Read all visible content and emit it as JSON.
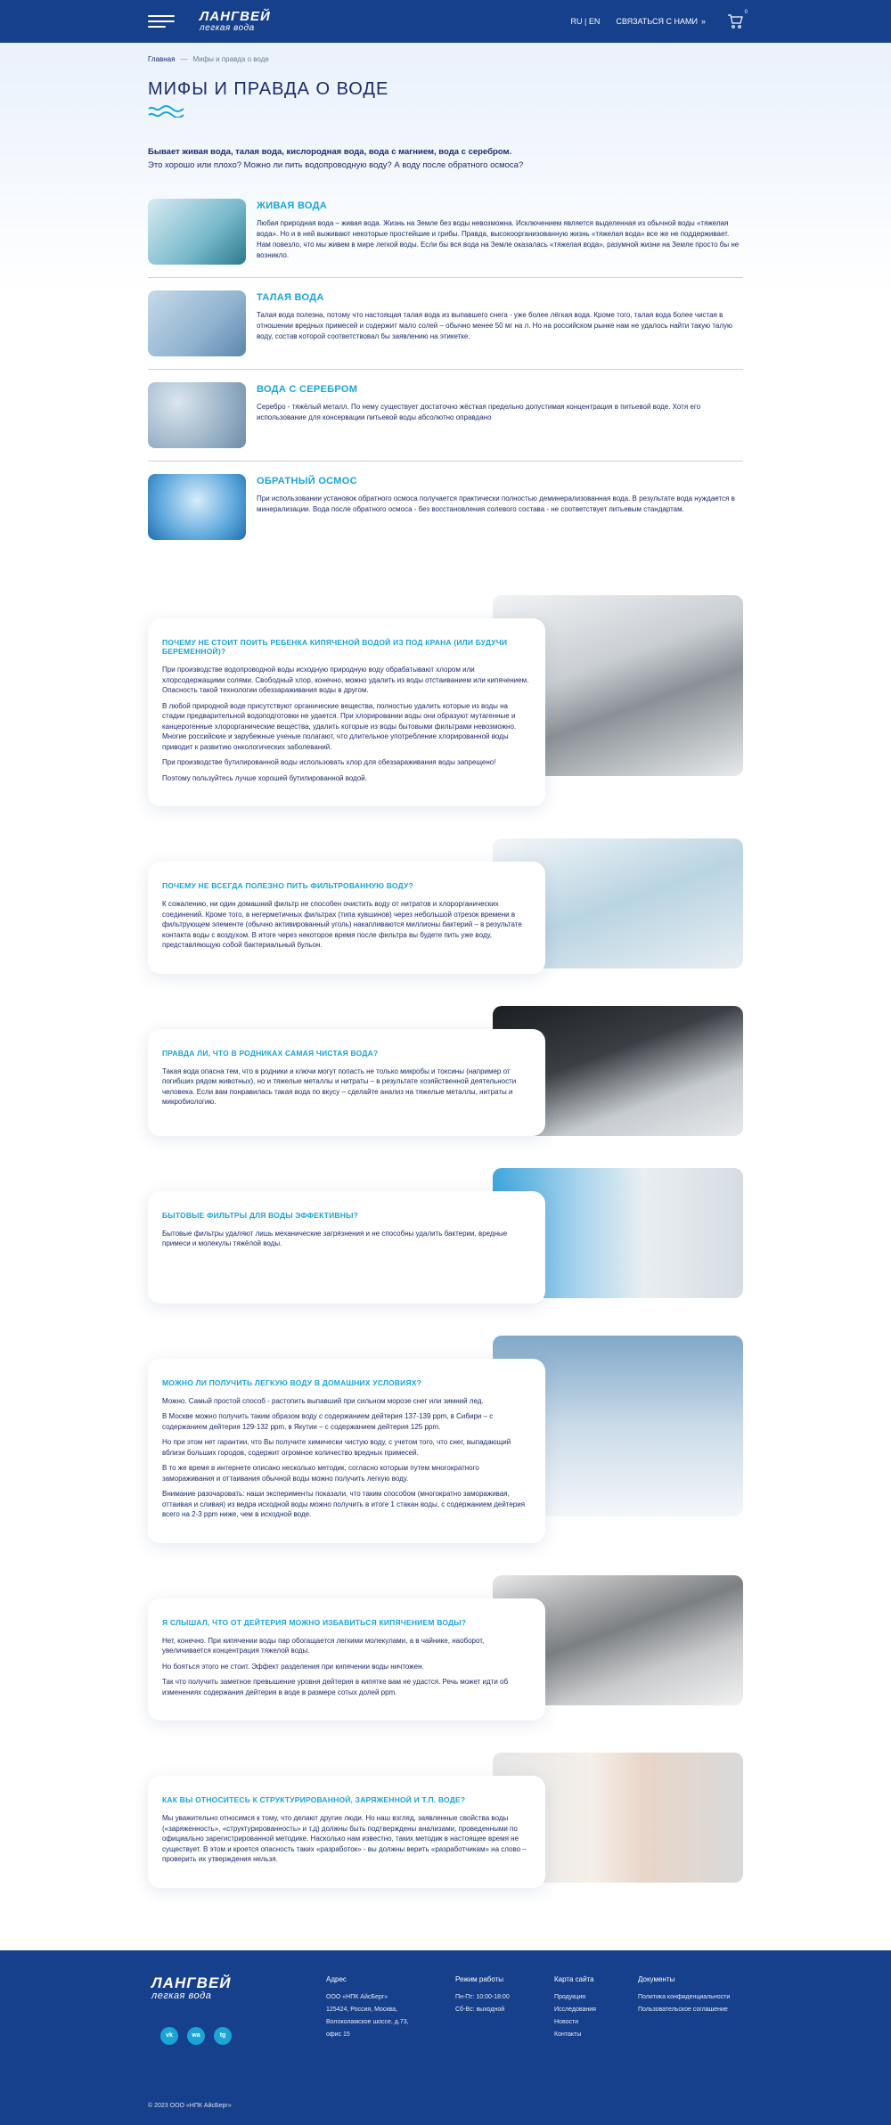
{
  "header": {
    "logo_main": "ЛАНГВЕЙ",
    "logo_sub": "легкая вода",
    "lang": "RU | EN",
    "contact": "СВЯЗАТЬСЯ С НАМИ",
    "cart_count": "0"
  },
  "breadcrumb": {
    "home": "Главная",
    "sep": "—",
    "current": "Мифы и правда о воде"
  },
  "title": "МИФЫ И ПРАВДА О ВОДЕ",
  "intro": {
    "bold": "Бывает живая вода, талая вода, кислородная вода, вода с магнием, вода с серебром.",
    "normal": "Это хорошо или плохо? Можно ли пить водопроводную воду? А воду после обратного осмоса?"
  },
  "topics": [
    {
      "title": "ЖИВАЯ ВОДА",
      "text": "Любая природная вода – живая вода. Жизнь на Земле без воды невозможна. Исключением является выделенная из обычной воды «тяжелая вода». Но и в ней выживают некоторые простейшие и грибы. Правда, высокоорганизованную жизнь «тяжелая вода» все же не поддерживает. Нам повезло, что мы живем в мире легкой воды. Если бы вся вода на Земле оказалась «тяжелая вода», разумной жизни на Земле просто бы не возникло."
    },
    {
      "title": "ТАЛАЯ ВОДА",
      "text": "Талая вода полезна, потому что настоящая талая вода из выпавшего снега - уже более лёгкая вода. Кроме того, талая вода более чистая в отношении вредных примесей и содержит мало солей – обычно менее 50 мг на л. Но на российском рынке нам не удалось найти такую талую воду, состав которой соответствовал бы заявлению на этикетке."
    },
    {
      "title": "ВОДА С СЕРЕБРОМ",
      "text": "Серебро - тяжёлый металл. По нему существует достаточно жёсткая предельно допустимая концентрация в питьевой воде. Хотя его использование для консервации питьевой воды абсолютно оправдано"
    },
    {
      "title": "ОБРАТНЫЙ ОСМОС",
      "text": "При использовании установок обратного осмоса получается практически полностью деминерализованная вода. В результате вода нуждается в минерализации. Вода после обратного осмоса - без восстановления солевого состава - не соответствует питьевым стандартам."
    }
  ],
  "qa": [
    {
      "title": "ПОЧЕМУ НЕ СТОИТ ПОИТЬ РЕБЕНКА КИПЯЧЕНОЙ ВОДОЙ ИЗ ПОД КРАНА (ИЛИ БУДУЧИ БЕРЕМЕННОЙ)?",
      "paras": [
        "При производстве водопроводной воды исходную природную воду обрабатывают хлором или хлорсодержащими солями. Свободный хлор, конечно, можно удалить из воды отстаиванием или кипячением. Опасность такой технологии обеззараживания воды в другом.",
        "В любой природной воде присутствуют органические вещества, полностью удалить которые из воды на стадии предварительной водоподготовки не удается. При хлорировании воды они образуют мутагенные и канцерогенные хлорорганические вещества, удалить которые из воды бытовыми фильтрами невозможно. Многие российские и зарубежные ученые полагают, что длительное употребление хлорированной воды приводит к развитию онкологических заболеваний.",
        "При производстве бутилированной воды использовать хлор для обеззараживания воды запрещено!",
        "Поэтому пользуйтесь лучше хорошей бутилированной водой."
      ]
    },
    {
      "title": "ПОЧЕМУ НЕ ВСЕГДА ПОЛЕЗНО ПИТЬ ФИЛЬТРОВАННУЮ ВОДУ?",
      "paras": [
        "К сожалению, ни один домашний фильтр не способен очистить воду от нитратов и хлорорганических соединений. Кроме того, в негерметичных фильтрах (типа кувшинов) через небольшой отрезок времени в фильтрующем элементе (обычно активированный уголь) накапливаются миллионы бактерий – в результате контакта воды с воздухом. В итоге через некоторое время после фильтра вы будете пить уже воду, представляющую собой бактериальный бульон."
      ]
    },
    {
      "title": "ПРАВДА ЛИ, ЧТО В РОДНИКАХ САМАЯ ЧИСТАЯ ВОДА?",
      "paras": [
        "Такая вода опасна тем, что в родники и ключи могут попасть не только микробы и токсины (например от погибших рядом животных), но и тяжелые металлы и нитраты – в результате хозяйственной деятельности человека. Если вам понравилась такая вода по вкусу – сделайте анализ на тяжелые металлы, нитраты и микробиологию."
      ]
    },
    {
      "title": "БЫТОВЫЕ ФИЛЬТРЫ ДЛЯ ВОДЫ ЭФФЕКТИВНЫ?",
      "paras": [
        "Бытовые фильтры удаляют лишь механические загрязнения и не способны удалить бактерии, вредные примеси и молекулы тяжёлой воды."
      ]
    },
    {
      "title": "МОЖНО ЛИ ПОЛУЧИТЬ ЛЕГКУЮ ВОДУ В ДОМАШНИХ УСЛОВИЯХ?",
      "paras": [
        "Можно. Самый простой способ - растопить выпавший при сильном морозе снег или зимний лед.",
        "В Москве можно получить таким образом воду с содержанием дейтерия 137-139 ppm, в Сибири – с содержанием дейтерия 129-132 ppm, в Якутии – с содержанием дейтерия 125 ppm.",
        "Но при этом нет гарантии, что Вы получите химически чистую воду, с учетом того, что снег, выпадающий вблизи больших городов, содержит огромное количество вредных примесей.",
        "В то же время в интернете описано несколько методик, согласно которым путем многократного замораживания и оттаивания обычной воды можно получить легкую воду.",
        "Внимание разочаровать: наши эксперименты показали, что таким способом (многократно замораживая, оттаивая и сливая) из ведра исходной воды можно получить в итоге 1 стакан воды, с содержанием дейтерия всего на 2-3 ppm ниже, чем в исходной воде."
      ]
    },
    {
      "title": "Я СЛЫШАЛ, ЧТО ОТ ДЕЙТЕРИЯ МОЖНО ИЗБАВИТЬСЯ КИПЯЧЕНИЕМ ВОДЫ?",
      "paras": [
        "Нет, конечно. При кипячении воды пар обогащается легкими молекулами, а в чайнике, наоборот, увеличивается концентрация тяжелой воды.",
        "Но бояться этого не стоит. Эффект разделения при кипячении воды ничтожен.",
        "Так что получить заметное превышение уровня дейтерия в кипятке вам не удастся. Речь может идти об изменениях содержания дейтерия в воде в размере сотых долей ppm."
      ]
    },
    {
      "title": "КАК ВЫ ОТНОСИТЕСЬ К СТРУКТУРИРОВАННОЙ, ЗАРЯЖЕННОЙ И Т.П. ВОДЕ?",
      "paras": [
        "Мы уважительно относимся к тому, что делают другие люди. Но наш взгляд, заявленные свойства воды («заряженность», «структурированность» и т.д) должны быть подтверждены анализами, проведенными по официально зарегистрированной методике. Насколько нам известно, таких методик в настоящее время не существует. В этом и кроется опасность таких «разработок» - вы должны верить «разработчикам» на слово – проверить их утверждения нельзя."
      ]
    }
  ],
  "footer": {
    "logo_main": "ЛАНГВЕЙ",
    "logo_sub": "легкая вода",
    "address_title": "Адрес",
    "address_lines": [
      "ООО «НПК АйсБерг»",
      "125424, Россия, Москва,",
      "Волоколамское шоссе, д.73,",
      "офис 15"
    ],
    "mode_title": "Режим работы",
    "mode_lines": [
      "Пн-Пт: 10:00-18:00",
      "Сб-Вс: выходной"
    ],
    "map_title": "Карта сайта",
    "map_links": [
      "Продукция",
      "Исследования",
      "Новости",
      "Контакты"
    ],
    "docs_title": "Документы",
    "docs_links": [
      "Политика конфиденциальности",
      "Пользовательское соглашение"
    ],
    "socials": [
      "vk",
      "wa",
      "tg"
    ],
    "copyright": "© 2023 ООО «НПК АйсБерг»"
  },
  "colors": {
    "brand": "#163f8c",
    "accent": "#1aa4d8",
    "text": "#1a2b6d"
  }
}
